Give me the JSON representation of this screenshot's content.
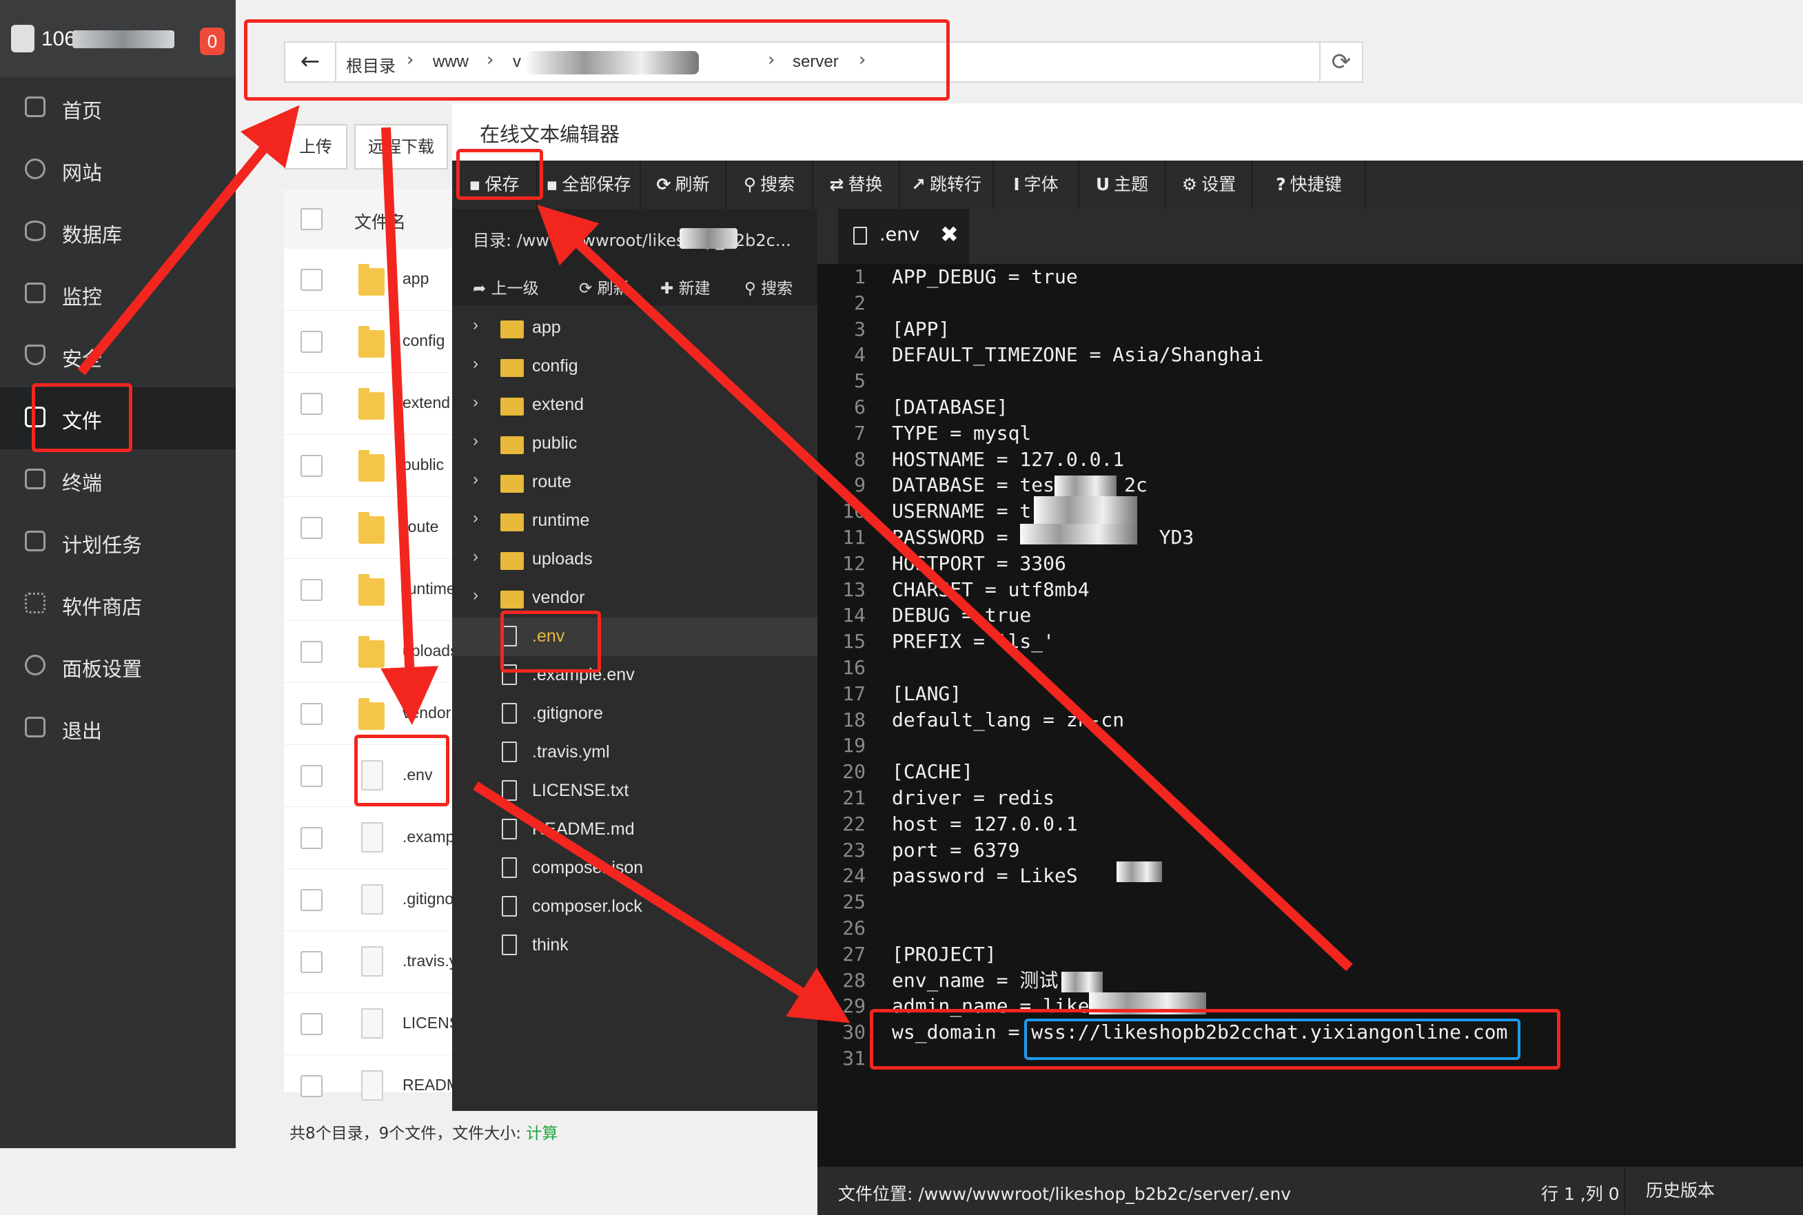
{
  "sidebar": {
    "logo_text": "106",
    "badge": "0",
    "items": [
      {
        "label": "首页",
        "icon": "home-icon"
      },
      {
        "label": "网站",
        "icon": "globe-icon"
      },
      {
        "label": "数据库",
        "icon": "database-icon"
      },
      {
        "label": "监控",
        "icon": "monitor-icon"
      },
      {
        "label": "安全",
        "icon": "shield-icon"
      },
      {
        "label": "文件",
        "icon": "folder-icon"
      },
      {
        "label": "终端",
        "icon": "terminal-icon"
      },
      {
        "label": "计划任务",
        "icon": "calendar-icon"
      },
      {
        "label": "软件商店",
        "icon": "grid-icon"
      },
      {
        "label": "面板设置",
        "icon": "gear-icon"
      },
      {
        "label": "退出",
        "icon": "logout-icon"
      }
    ]
  },
  "pathbar": {
    "back": "←",
    "crumbs": [
      "根目录",
      "www",
      "v",
      "server"
    ],
    "sep": "›",
    "refresh": "⟳"
  },
  "files": {
    "upload": "上传",
    "remote_download": "远程下载",
    "header": "文件名",
    "rows": [
      {
        "name": "app",
        "type": "folder"
      },
      {
        "name": "config",
        "type": "folder"
      },
      {
        "name": "extend",
        "type": "folder"
      },
      {
        "name": "public",
        "type": "folder"
      },
      {
        "name": "route",
        "type": "folder"
      },
      {
        "name": "runtime",
        "type": "folder"
      },
      {
        "name": "uploads",
        "type": "folder"
      },
      {
        "name": "vendor",
        "type": "folder"
      },
      {
        "name": ".env",
        "type": "file"
      },
      {
        "name": ".example.env",
        "type": "file"
      },
      {
        "name": ".gitignore",
        "type": "file"
      },
      {
        "name": ".travis.yml",
        "type": "file"
      },
      {
        "name": "LICENSE.txt",
        "type": "file"
      },
      {
        "name": "README.md",
        "type": "file"
      }
    ],
    "footer_text": "共8个目录，9个文件，文件大小: ",
    "footer_calc": "计算"
  },
  "editor": {
    "title": "在线文本编辑器",
    "toolbar": [
      {
        "glyph": "▪",
        "label": "保存"
      },
      {
        "glyph": "▪",
        "label": "全部保存"
      },
      {
        "glyph": "⟳",
        "label": "刷新"
      },
      {
        "glyph": "⚲",
        "label": "搜索"
      },
      {
        "glyph": "⇄",
        "label": "替换"
      },
      {
        "glyph": "↗",
        "label": "跳转行"
      },
      {
        "glyph": "I",
        "label": "字体"
      },
      {
        "glyph": "U",
        "label": "主题"
      },
      {
        "glyph": "⚙",
        "label": "设置"
      },
      {
        "glyph": "?",
        "label": "快捷键"
      }
    ],
    "tree_dir": "目录: /www/wwwroot/likeshop_b2b2c...",
    "tree_tools": [
      "上一级",
      "刷新",
      "新建",
      "搜索"
    ],
    "tree": [
      {
        "name": "app",
        "type": "folder"
      },
      {
        "name": "config",
        "type": "folder"
      },
      {
        "name": "extend",
        "type": "folder"
      },
      {
        "name": "public",
        "type": "folder"
      },
      {
        "name": "route",
        "type": "folder"
      },
      {
        "name": "runtime",
        "type": "folder"
      },
      {
        "name": "uploads",
        "type": "folder"
      },
      {
        "name": "vendor",
        "type": "folder"
      },
      {
        "name": ".env",
        "type": "file",
        "active": true
      },
      {
        "name": ".example.env",
        "type": "file"
      },
      {
        "name": ".gitignore",
        "type": "file"
      },
      {
        "name": ".travis.yml",
        "type": "file"
      },
      {
        "name": "LICENSE.txt",
        "type": "file"
      },
      {
        "name": "README.md",
        "type": "file"
      },
      {
        "name": "composer.json",
        "type": "file"
      },
      {
        "name": "composer.lock",
        "type": "file"
      },
      {
        "name": "think",
        "type": "file"
      }
    ],
    "tab": {
      "label": ".env",
      "close": "✖"
    },
    "code": [
      "APP_DEBUG = true",
      "",
      "[APP]",
      "DEFAULT_TIMEZONE = Asia/Shanghai",
      "",
      "[DATABASE]",
      "TYPE = mysql",
      "HOSTNAME = 127.0.0.1",
      "DATABASE = tes      2c",
      "USERNAME = t     b",
      "PASSWORD = kC          YD3",
      "HOSTPORT = 3306",
      "CHARSET = utf8mb4",
      "DEBUG = true",
      "PREFIX = 'ls_'",
      "",
      "[LANG]",
      "default_lang = zh-cn",
      "",
      "[CACHE]",
      "driver = redis",
      "host = 127.0.0.1",
      "port = 6379",
      "password = LikeS",
      "",
      "",
      "[PROJECT]",
      "env_name = 测试",
      "admin_name = likesh",
      "ws_domain = wss://likeshopb2b2cchat.yixiangonline.com",
      ""
    ],
    "status_location": "文件位置: /www/wwwroot/likeshop_b2b2c/server/.env",
    "status_pos": "行 1 ,列 0",
    "status_history": "历史版本"
  }
}
